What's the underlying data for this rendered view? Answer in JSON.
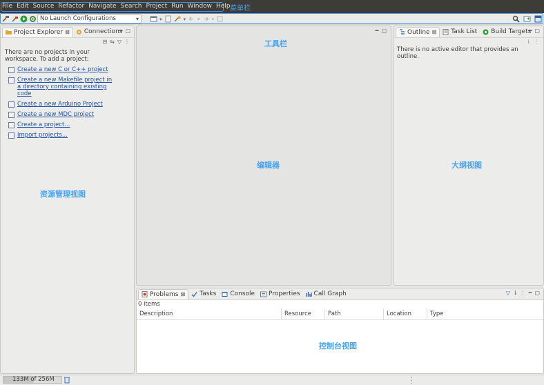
{
  "menubar": {
    "items": [
      "File",
      "Edit",
      "Source",
      "Refactor",
      "Navigate",
      "Search",
      "Project",
      "Run",
      "Window",
      "Help"
    ],
    "annotation": "菜单栏"
  },
  "toolbar": {
    "launch_config": "No Launch Configurations",
    "annotation": "工具栏"
  },
  "project_explorer": {
    "tabs": [
      "Project Explorer",
      "Connections"
    ],
    "message": "There are no projects in your workspace. To add a project:",
    "links": [
      {
        "label": "Create a new C or C++ project",
        "icon": "c-project-icon"
      },
      {
        "label": "Create a new Makefile project in a directory containing existing code",
        "icon": "makefile-project-icon"
      },
      {
        "label": "Create a new Arduino Project",
        "icon": "arduino-project-icon"
      },
      {
        "label": "Create a new MDC project",
        "icon": "mdc-project-icon"
      },
      {
        "label": "Create a project...",
        "icon": "new-project-icon"
      },
      {
        "label": "Import projects...",
        "icon": "import-icon"
      }
    ],
    "annotation": "资源管理视图"
  },
  "editor": {
    "annotation": "编辑器"
  },
  "outline": {
    "tabs": [
      "Outline",
      "Task List",
      "Build Targets"
    ],
    "message": "There is no active editor that provides an outline.",
    "annotation": "大纲视图"
  },
  "console": {
    "tabs": [
      "Problems",
      "Tasks",
      "Console",
      "Properties",
      "Call Graph"
    ],
    "item_count": "0 items",
    "columns": [
      "Description",
      "Resource",
      "Path",
      "Location",
      "Type"
    ],
    "annotation": "控制台视图"
  },
  "statusbar": {
    "heap": "133M of 256M",
    "heap_fraction": 0.52
  },
  "colors": {
    "annotation": "#4aa3f0",
    "menubar_bg": "#3d3c37",
    "link": "#2152a8"
  }
}
